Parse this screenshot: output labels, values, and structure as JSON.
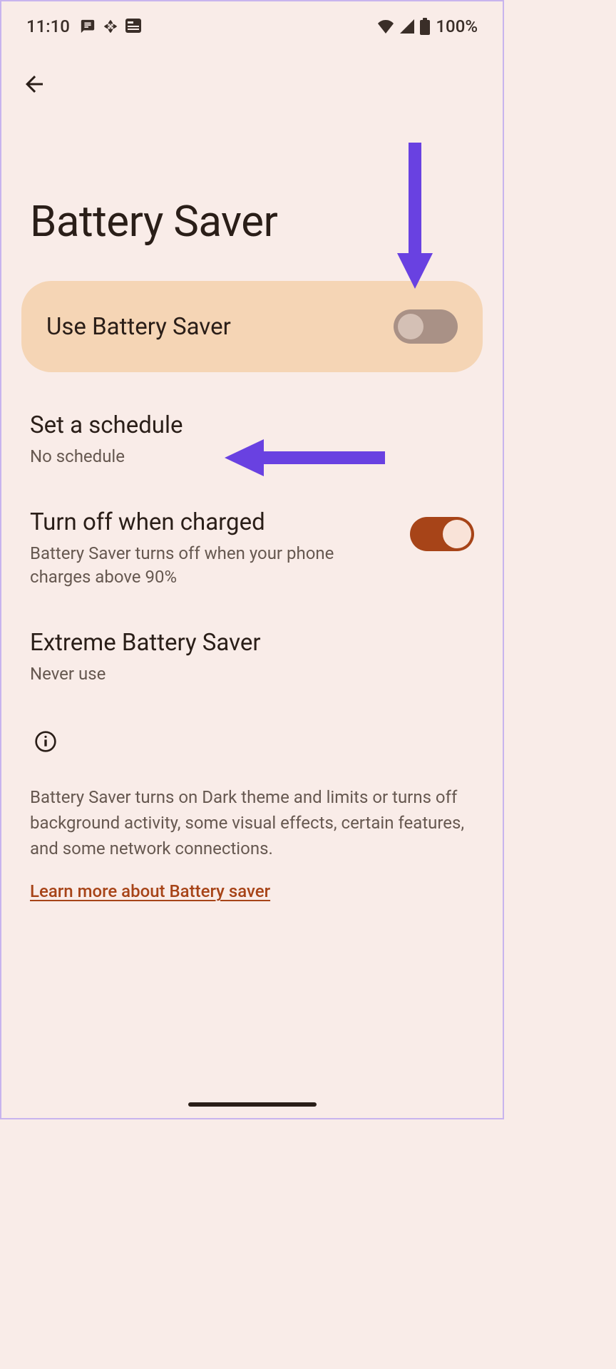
{
  "status_bar": {
    "time": "11:10",
    "battery_pct": "100%"
  },
  "page": {
    "title": "Battery Saver"
  },
  "main_toggle": {
    "label": "Use Battery Saver",
    "state": "off"
  },
  "settings": {
    "schedule": {
      "title": "Set a schedule",
      "subtitle": "No schedule"
    },
    "turn_off_charged": {
      "title": "Turn off when charged",
      "subtitle": "Battery Saver turns off when your phone charges above 90%",
      "state": "on"
    },
    "extreme": {
      "title": "Extreme Battery Saver",
      "subtitle": "Never use"
    }
  },
  "info": {
    "text": "Battery Saver turns on Dark theme and limits or turns off background activity, some visual effects, certain features, and some network connections.",
    "link": "Learn more about Battery saver"
  },
  "colors": {
    "background": "#f9ece8",
    "card": "#f5d5b5",
    "accent": "#a74418",
    "text_primary": "#2a1e18",
    "text_secondary": "#665850",
    "arrow": "#6941e1"
  }
}
